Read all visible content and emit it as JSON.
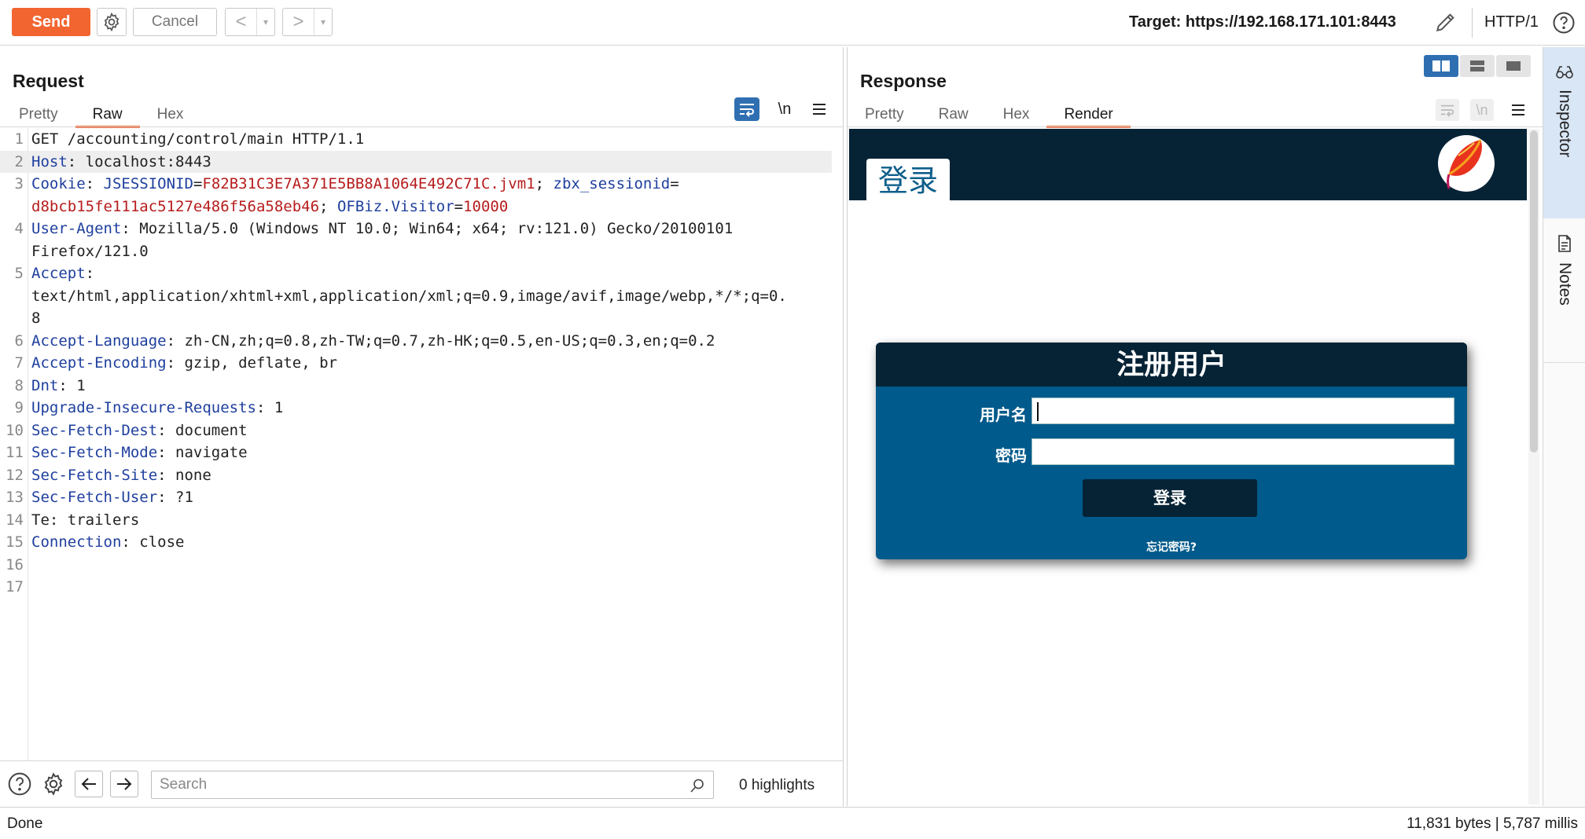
{
  "toolbar": {
    "send_label": "Send",
    "cancel_label": "Cancel",
    "back_glyph": "<",
    "forward_glyph": ">",
    "dropdown_glyph": "▾",
    "target_label": "Target: https://192.168.171.101:8443",
    "protocol_label": "HTTP/1"
  },
  "request": {
    "title": "Request",
    "tabs": [
      "Pretty",
      "Raw",
      "Hex"
    ],
    "active_tab": "Raw",
    "newline_toggle": "\\n",
    "lines": [
      {
        "n": "1",
        "text": "GET /accounting/control/main HTTP/1.1"
      },
      {
        "n": "2",
        "key": "Host",
        "sep": ": ",
        "val": "localhost:8443"
      },
      {
        "n": "3",
        "key": "Cookie",
        "sep": ": ",
        "val": ""
      },
      {
        "n": "",
        "text": ""
      },
      {
        "n": "4",
        "key": "User-Agent",
        "sep": ": ",
        "val": "Mozilla/5.0 (Windows NT 10.0; Win64; x64; rv:121.0) Gecko/20100101"
      },
      {
        "n": "",
        "text": "Firefox/121.0"
      },
      {
        "n": "5",
        "key": "Accept",
        "sep": ":",
        "val": ""
      },
      {
        "n": "",
        "text": "text/html,application/xhtml+xml,application/xml;q=0.9,image/avif,image/webp,*/*;q=0."
      },
      {
        "n": "",
        "text": "8"
      },
      {
        "n": "6",
        "key": "Accept-Language",
        "sep": ": ",
        "val": "zh-CN,zh;q=0.8,zh-TW;q=0.7,zh-HK;q=0.5,en-US;q=0.3,en;q=0.2"
      },
      {
        "n": "7",
        "key": "Accept-Encoding",
        "sep": ": ",
        "val": "gzip, deflate, br"
      },
      {
        "n": "8",
        "key": "Dnt",
        "sep": ": ",
        "val": "1"
      },
      {
        "n": "9",
        "key": "Upgrade-Insecure-Requests",
        "sep": ": ",
        "val": "1"
      },
      {
        "n": "10",
        "key": "Sec-Fetch-Dest",
        "sep": ": ",
        "val": "document"
      },
      {
        "n": "11",
        "key": "Sec-Fetch-Mode",
        "sep": ": ",
        "val": "navigate"
      },
      {
        "n": "12",
        "key": "Sec-Fetch-Site",
        "sep": ": ",
        "val": "none"
      },
      {
        "n": "13",
        "key": "Sec-Fetch-User",
        "sep": ": ",
        "val": "?1"
      },
      {
        "n": "14",
        "text": "Te: trailers"
      },
      {
        "n": "15",
        "key": "Connection",
        "sep": ": ",
        "val": "close"
      },
      {
        "n": "16",
        "text": ""
      },
      {
        "n": "17",
        "text": ""
      }
    ],
    "cookie": {
      "jsession_key": "JSESSIONID",
      "jsession_val": "F82B31C3E7A371E5BB8A1064E492C71C.jvm1",
      "zbx_key": "zbx_sessionid",
      "zbx_val": "d8bcb15fe111ac5127e486f56a58eb46",
      "ofbiz_key": "OFBiz.Visitor",
      "ofbiz_val": "10000"
    },
    "search_placeholder": "Search",
    "highlights": "0 highlights"
  },
  "response": {
    "title": "Response",
    "tabs": [
      "Pretty",
      "Raw",
      "Hex",
      "Render"
    ],
    "active_tab": "Render",
    "newline_toggle": "\\n",
    "render": {
      "header_tab": "登录",
      "login_title": "注册用户",
      "username_label": "用户名",
      "password_label": "密码",
      "login_button": "登录",
      "forgot_link": "忘记密码?"
    }
  },
  "side": {
    "inspector_label": "Inspector",
    "notes_label": "Notes"
  },
  "status": {
    "left": "Done",
    "right": "11,831 bytes | 5,787 millis"
  },
  "colors": {
    "accent": "#f26531",
    "header_key": "#1e3f9e",
    "value_red": "#b71c1c",
    "render_dark": "#062336",
    "render_blue": "#005a8b"
  }
}
